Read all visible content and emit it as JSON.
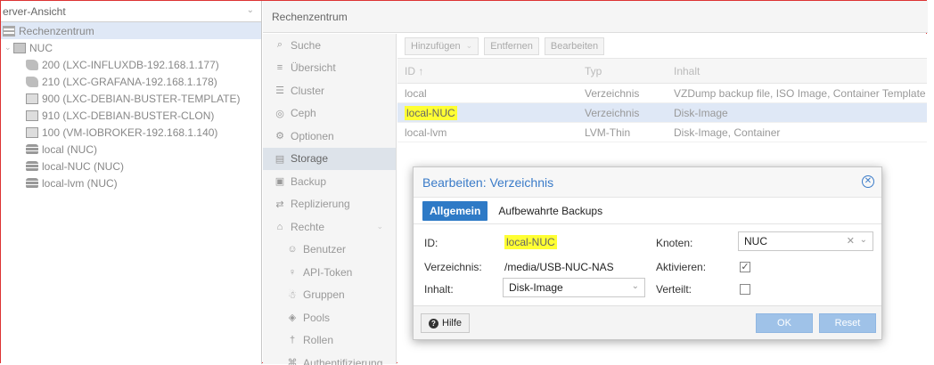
{
  "tree": {
    "view_label": "erver-Ansicht",
    "items": [
      {
        "label": "Rechenzentrum",
        "icon": "datacenter-icon",
        "selected": true
      },
      {
        "label": "NUC",
        "icon": "node-icon"
      },
      {
        "label": "200 (LXC-INFLUXDB-192.168.1.177)",
        "icon": "container-icon"
      },
      {
        "label": "210 (LXC-GRAFANA-192.168.1.178)",
        "icon": "container-icon"
      },
      {
        "label": "900 (LXC-DEBIAN-BUSTER-TEMPLATE)",
        "icon": "template-icon"
      },
      {
        "label": "910 (LXC-DEBIAN-BUSTER-CLON)",
        "icon": "template-icon"
      },
      {
        "label": "100 (VM-IOBROKER-192.168.1.140)",
        "icon": "vm-icon"
      },
      {
        "label": "local (NUC)",
        "icon": "storage-icon"
      },
      {
        "label": "local-NUC (NUC)",
        "icon": "storage-icon"
      },
      {
        "label": "local-lvm (NUC)",
        "icon": "storage-icon"
      }
    ]
  },
  "topbar": {
    "title": "Rechenzentrum"
  },
  "menu": {
    "items": [
      {
        "label": "Suche",
        "icon": "⌕"
      },
      {
        "label": "Übersicht",
        "icon": "≡"
      },
      {
        "label": "Cluster",
        "icon": "☰"
      },
      {
        "label": "Ceph",
        "icon": "◎"
      },
      {
        "label": "Optionen",
        "icon": "⚙"
      },
      {
        "label": "Storage",
        "icon": "▤"
      },
      {
        "label": "Backup",
        "icon": "▣"
      },
      {
        "label": "Replizierung",
        "icon": "⇄"
      },
      {
        "label": "Rechte",
        "icon": "⌂"
      },
      {
        "label": "Benutzer",
        "icon": "☺"
      },
      {
        "label": "API-Token",
        "icon": "♀"
      },
      {
        "label": "Gruppen",
        "icon": "☃"
      },
      {
        "label": "Pools",
        "icon": "◈"
      },
      {
        "label": "Rollen",
        "icon": "†"
      },
      {
        "label": "Authentifizierung",
        "icon": "⌘"
      }
    ]
  },
  "toolbar": {
    "add": "Hinzufügen",
    "remove": "Entfernen",
    "edit": "Bearbeiten"
  },
  "grid": {
    "headers": {
      "id": "ID ↑",
      "typ": "Typ",
      "inhalt": "Inhalt"
    },
    "rows": [
      {
        "id": "local",
        "typ": "Verzeichnis",
        "inhalt": "VZDump backup file, ISO Image, Container Template"
      },
      {
        "id": "local-NUC",
        "typ": "Verzeichnis",
        "inhalt": "Disk-Image"
      },
      {
        "id": "local-lvm",
        "typ": "LVM-Thin",
        "inhalt": "Disk-Image, Container"
      }
    ]
  },
  "dialog": {
    "title": "Bearbeiten: Verzeichnis",
    "tabs": [
      "Allgemein",
      "Aufbewahrte Backups"
    ],
    "fields": {
      "id_label": "ID:",
      "id_value": "local-NUC",
      "dir_label": "Verzeichnis:",
      "dir_value": "/media/USB-NUC-NAS",
      "content_label": "Inhalt:",
      "content_value": "Disk-Image",
      "node_label": "Knoten:",
      "node_value": "NUC",
      "enable_label": "Aktivieren:",
      "enable_checked": true,
      "shared_label": "Verteilt:",
      "shared_checked": false
    },
    "buttons": {
      "help": "Hilfe",
      "ok": "OK",
      "reset": "Reset"
    }
  }
}
